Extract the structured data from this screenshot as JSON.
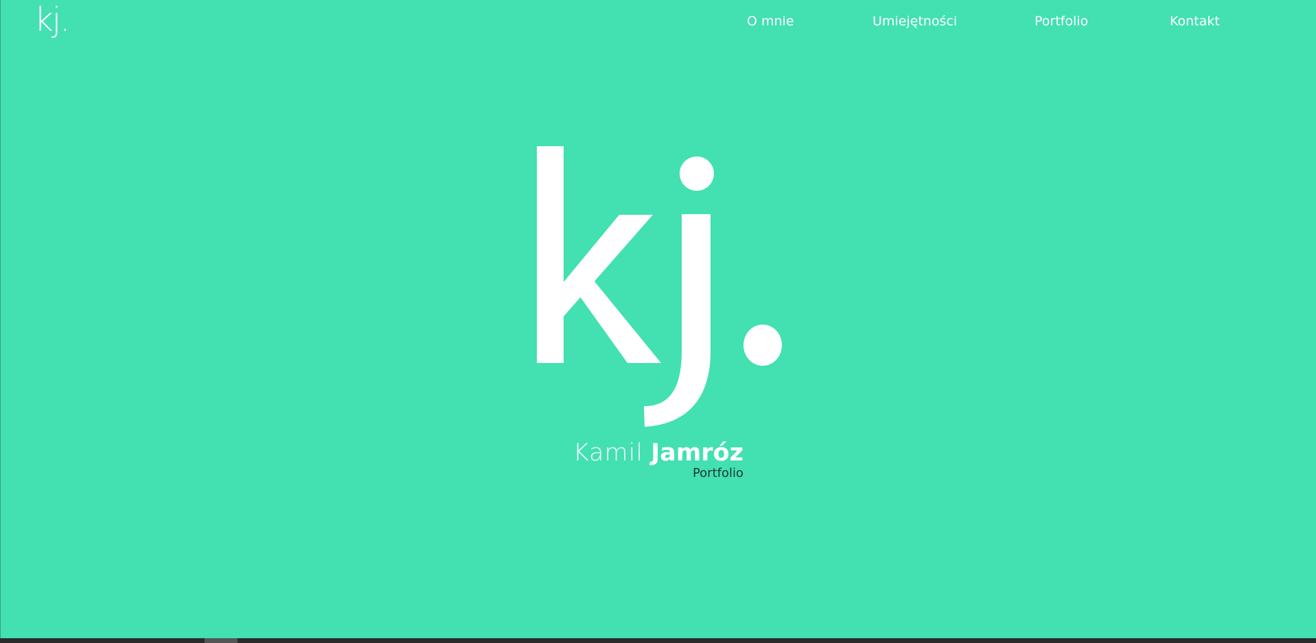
{
  "header": {
    "logo_text": "kj.",
    "nav": [
      {
        "label": "O mnie"
      },
      {
        "label": "Umiejętności"
      },
      {
        "label": "Portfolio"
      },
      {
        "label": "Kontakt"
      }
    ]
  },
  "hero": {
    "logo_text": "kj.",
    "first_name": "Kamil",
    "last_name": "Jamróz",
    "subtitle": "Portfolio"
  },
  "colors": {
    "background": "#43e0b1",
    "foreground": "#ffffff",
    "subtitle": "#1d3a33"
  }
}
